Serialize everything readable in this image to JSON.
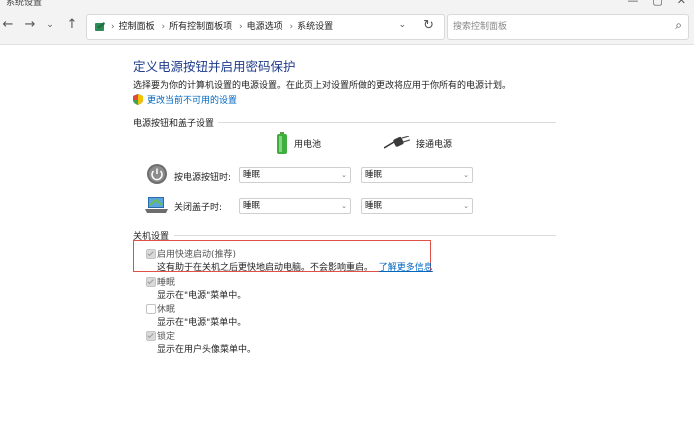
{
  "window": {
    "title": "系统设置"
  },
  "nav": {
    "breadcrumbs": [
      "控制面板",
      "所有控制面板项",
      "电源选项",
      "系统设置"
    ],
    "search_placeholder": "搜索控制面板"
  },
  "page": {
    "heading": "定义电源按钮并启用密码保护",
    "description": "选择要为你的计算机设置的电源设置。在此页上对设置所做的更改将应用于你所有的电源计划。",
    "change_link": "更改当前不可用的设置"
  },
  "power_buttons": {
    "section_title": "电源按钮和盖子设置",
    "col_battery": "用电池",
    "col_plugged": "接通电源",
    "rows": [
      {
        "label": "按电源按钮时:",
        "battery": "睡眠",
        "plugged": "睡眠"
      },
      {
        "label": "关闭盖子时:",
        "battery": "睡眠",
        "plugged": "睡眠"
      }
    ]
  },
  "shutdown": {
    "section_title": "关机设置",
    "options": [
      {
        "label": "启用快速启动(推荐)",
        "desc": "这有助于在关机之后更快地启动电脑。不会影响重启。",
        "link": "了解更多信息",
        "checked": true
      },
      {
        "label": "睡眠",
        "desc": "显示在\"电源\"菜单中。",
        "checked": true
      },
      {
        "label": "休眠",
        "desc": "显示在\"电源\"菜单中。",
        "checked": false
      },
      {
        "label": "锁定",
        "desc": "显示在用户头像菜单中。",
        "checked": true
      }
    ]
  },
  "colors": {
    "heading": "#1e3a8a",
    "link": "#0067c0",
    "highlight_box": "#e05246"
  }
}
